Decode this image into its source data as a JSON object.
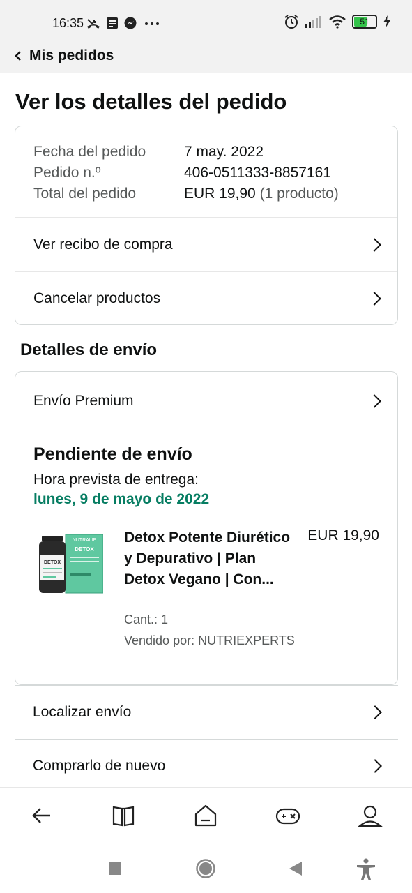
{
  "status_bar": {
    "time": "16:35",
    "battery": "51",
    "icons": [
      "missed-call-icon",
      "message-icon",
      "messenger-icon",
      "more-dots-icon",
      "alarm-icon",
      "signal-icon",
      "wifi-icon",
      "battery-icon",
      "charging-icon"
    ]
  },
  "header": {
    "back_label": "Mis pedidos"
  },
  "page": {
    "title": "Ver los detalles del pedido"
  },
  "order_summary": {
    "date_label": "Fecha del pedido",
    "date_value": "7 may. 2022",
    "number_label": "Pedido n.º",
    "number_value": "406-0511333-8857161",
    "total_label": "Total del pedido",
    "total_value": "EUR 19,90",
    "total_count": "(1 producto)"
  },
  "order_actions": {
    "receipt": "Ver recibo de compra",
    "cancel": "Cancelar productos"
  },
  "shipping": {
    "section_title": "Detalles de envío",
    "method": "Envío Premium",
    "status": "Pendiente de envío",
    "eta_label": "Hora prevista de entrega:",
    "eta_date": "lunes, 9 de mayo de 2022",
    "eta_color": "#067d62"
  },
  "product": {
    "title": "Detox Potente Diurético y Depurativo | Plan Detox Vegano | Con...",
    "price": "EUR 19,90",
    "quantity": "Cant.: 1",
    "seller": "Vendido por: NUTRIEXPERTS",
    "image_brand": "NUTRALIE",
    "image_label": "DETOX"
  },
  "more_actions": {
    "track": "Localizar envío",
    "buy_again": "Comprarlo de nuevo"
  },
  "bottom_nav": {
    "items": [
      "back-arrow-icon",
      "book-icon",
      "home-icon",
      "gamepad-icon",
      "profile-icon"
    ]
  },
  "system_nav": {
    "items": [
      "recent-apps-icon",
      "home-circle-icon",
      "back-triangle-icon",
      "accessibility-icon"
    ]
  }
}
